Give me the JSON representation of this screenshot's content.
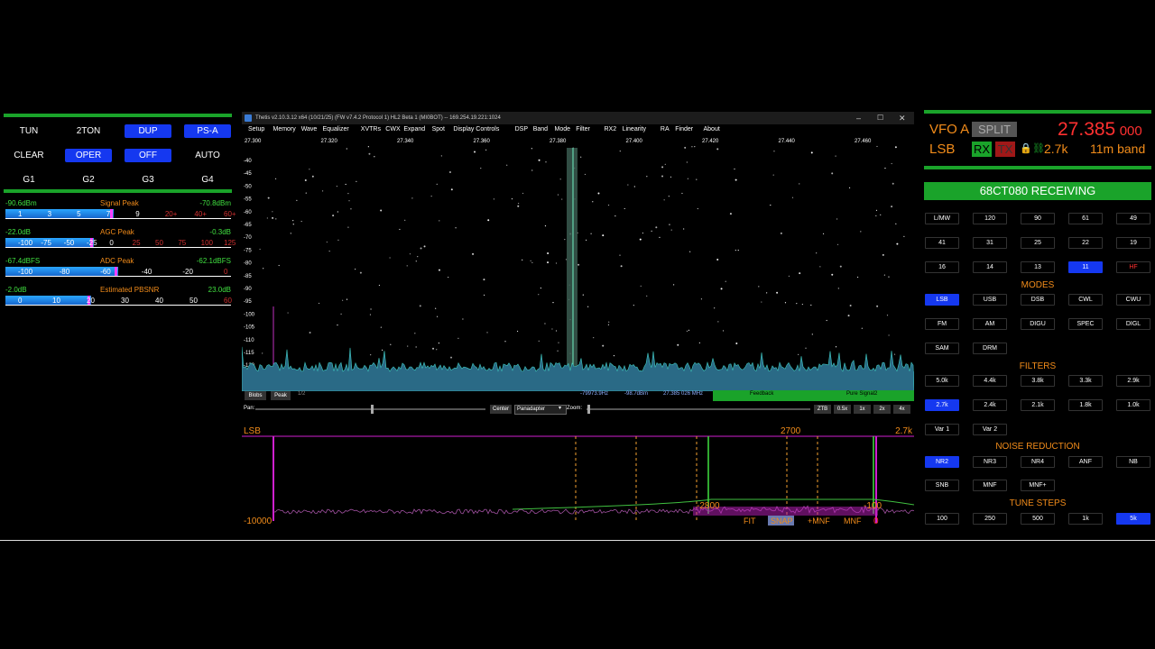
{
  "left": {
    "buttons": [
      {
        "label": "TUN",
        "on": false
      },
      {
        "label": "2TON",
        "on": false
      },
      {
        "label": "DUP",
        "on": true
      },
      {
        "label": "PS-A",
        "on": true
      },
      {
        "label": "CLEAR",
        "on": false
      },
      {
        "label": "OPER",
        "on": true
      },
      {
        "label": "OFF",
        "on": true
      },
      {
        "label": "AUTO",
        "on": false
      },
      {
        "label": "G1",
        "on": false
      },
      {
        "label": "G2",
        "on": false
      },
      {
        "label": "G3",
        "on": false
      },
      {
        "label": "G4",
        "on": false
      }
    ],
    "meters": [
      {
        "left": "-90.6dBm",
        "title": "Signal Peak",
        "right": "-70.8dBm",
        "fill": 0.48,
        "ticks": [
          "1",
          "3",
          "5",
          "7",
          "9",
          "20+",
          "40+",
          "60+"
        ]
      },
      {
        "left": "-22.0dB",
        "title": "AGC Peak",
        "right": "-0.3dB",
        "fill": 0.39,
        "ticks": [
          "-100",
          "-75",
          "-50",
          "-25",
          "0",
          "25",
          "50",
          "75",
          "100",
          "125"
        ]
      },
      {
        "left": "-67.4dBFS",
        "title": "ADC Peak",
        "right": "-62.1dBFS",
        "fill": 0.5,
        "ticks": [
          "-100",
          "-80",
          "-60",
          "-40",
          "-20",
          "0"
        ]
      },
      {
        "left": "-2.0dB",
        "title": "Estimated PBSNR",
        "right": "23.0dB",
        "fill": 0.38,
        "ticks": [
          "0",
          "10",
          "20",
          "30",
          "40",
          "50",
          "60"
        ]
      }
    ]
  },
  "window": {
    "title": "Thetis v2.10.3.12 x64 (10/21/25) (FW v7.4.2 Protocol 1) HL2 Beta 1 (MI0BOT)  --  169.254.19.221:1024",
    "menu": [
      "Setup",
      "Memory",
      "Wave",
      "Equalizer",
      "XVTRs",
      "CWX",
      "Expand",
      "Spot",
      "Display Controls",
      "DSP",
      "Band",
      "Mode",
      "Filter",
      "RX2",
      "Linearity",
      "RA",
      "Finder",
      "About"
    ],
    "freq_labels": [
      "27.300",
      "27.320",
      "27.340",
      "27.360",
      "27.380",
      "27.400",
      "27.420",
      "27.440",
      "27.460"
    ],
    "db_labels": [
      "-40",
      "-45",
      "-50",
      "-55",
      "-60",
      "-65",
      "-70",
      "-75",
      "-80",
      "-85",
      "-90",
      "-95",
      "-100",
      "-105",
      "-110",
      "-115",
      "-120",
      "-125"
    ],
    "status": {
      "blobs": "Blobs",
      "peak": "Peak",
      "page": "1/2",
      "hz": "-79973.9Hz",
      "dbm": "-98.7dBm",
      "mhz": "27.385 026 MHz",
      "feedback": "Feedback",
      "pure": "Pure Signal2"
    },
    "controls": {
      "pan": "Pan:",
      "center": "Center",
      "mode": "Panadapter",
      "zoom": "Zoom:",
      "buttons": [
        "ZTB",
        "0.5x",
        "1x",
        "2x",
        "4x"
      ]
    }
  },
  "bottom": {
    "mode": "LSB",
    "bw": "2700",
    "bwk": "2.7k",
    "low": "-10000",
    "m2800": "-2800",
    "m100": "-100",
    "actions": [
      "FIT",
      "SNAP",
      "+MNF",
      "MNF"
    ],
    "marker": "0"
  },
  "vfo": {
    "name": "VFO A",
    "split": "SPLIT",
    "freq_main": "27.385",
    "freq_sub": "000",
    "mode": "LSB",
    "rx": "RX",
    "tx": "TX",
    "bw": "2.7k",
    "band": "11m band",
    "receiving": "68CT080 RECEIVING"
  },
  "bands": [
    {
      "label": "L/MW",
      "on": false,
      "red": false
    },
    {
      "label": "120",
      "on": false,
      "red": false
    },
    {
      "label": "90",
      "on": false,
      "red": false
    },
    {
      "label": "61",
      "on": false,
      "red": false
    },
    {
      "label": "49",
      "on": false,
      "red": false
    },
    {
      "label": "41",
      "on": false,
      "red": false
    },
    {
      "label": "31",
      "on": false,
      "red": false
    },
    {
      "label": "25",
      "on": false,
      "red": false
    },
    {
      "label": "22",
      "on": false,
      "red": false
    },
    {
      "label": "19",
      "on": false,
      "red": false
    },
    {
      "label": "16",
      "on": false,
      "red": false
    },
    {
      "label": "14",
      "on": false,
      "red": false
    },
    {
      "label": "13",
      "on": false,
      "red": false
    },
    {
      "label": "11",
      "on": true,
      "red": false
    },
    {
      "label": "HF",
      "on": false,
      "red": true
    }
  ],
  "modes_title": "MODES",
  "modes": [
    {
      "label": "LSB",
      "on": true
    },
    {
      "label": "USB",
      "on": false
    },
    {
      "label": "DSB",
      "on": false
    },
    {
      "label": "CWL",
      "on": false
    },
    {
      "label": "CWU",
      "on": false
    },
    {
      "label": "FM",
      "on": false
    },
    {
      "label": "AM",
      "on": false
    },
    {
      "label": "DIGU",
      "on": false
    },
    {
      "label": "SPEC",
      "on": false
    },
    {
      "label": "DIGL",
      "on": false
    },
    {
      "label": "SAM",
      "on": false
    },
    {
      "label": "DRM",
      "on": false
    }
  ],
  "filters_title": "FILTERS",
  "filters": [
    {
      "label": "5.0k",
      "on": false
    },
    {
      "label": "4.4k",
      "on": false
    },
    {
      "label": "3.8k",
      "on": false
    },
    {
      "label": "3.3k",
      "on": false
    },
    {
      "label": "2.9k",
      "on": false
    },
    {
      "label": "2.7k",
      "on": true
    },
    {
      "label": "2.4k",
      "on": false
    },
    {
      "label": "2.1k",
      "on": false
    },
    {
      "label": "1.8k",
      "on": false
    },
    {
      "label": "1.0k",
      "on": false
    },
    {
      "label": "Var 1",
      "on": false
    },
    {
      "label": "Var 2",
      "on": false
    }
  ],
  "nr_title": "NOISE REDUCTION",
  "nr": [
    {
      "label": "NR2",
      "on": true
    },
    {
      "label": "NR3",
      "on": false
    },
    {
      "label": "NR4",
      "on": false
    },
    {
      "label": "ANF",
      "on": false
    },
    {
      "label": "NB",
      "on": false
    },
    {
      "label": "SNB",
      "on": false
    },
    {
      "label": "MNF",
      "on": false
    },
    {
      "label": "MNF+",
      "on": false
    }
  ],
  "steps_title": "TUNE STEPS",
  "steps": [
    {
      "label": "100",
      "on": false
    },
    {
      "label": "250",
      "on": false
    },
    {
      "label": "500",
      "on": false
    },
    {
      "label": "1k",
      "on": false
    },
    {
      "label": "5k",
      "on": true
    }
  ],
  "colors": {
    "green": "#1aa32a",
    "blue": "#1538f0",
    "orange": "#f28c1a",
    "red": "#ff3030",
    "accent_pink": "#d020d0"
  }
}
